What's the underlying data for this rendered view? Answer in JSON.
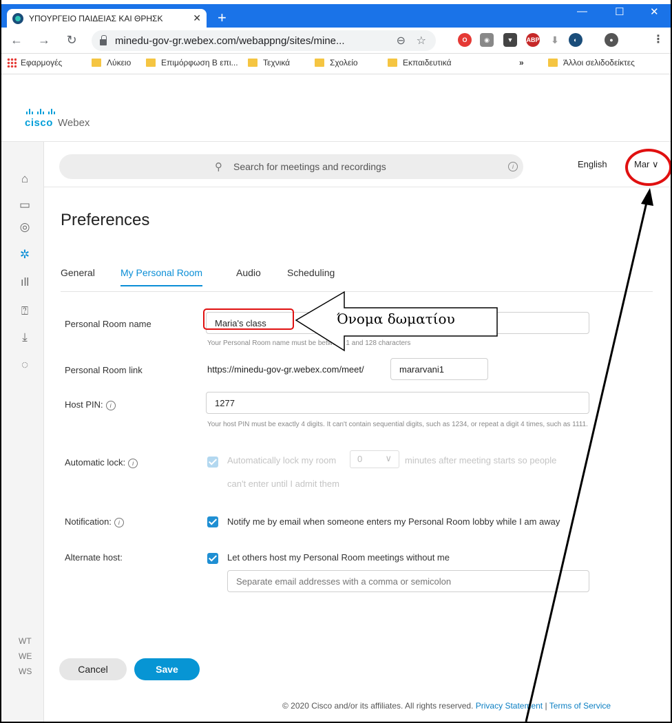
{
  "browser": {
    "tab_title": "ΥΠΟΥΡΓΕΙΟ ΠΑΙΔΕΙΑΣ ΚΑΙ ΘΡΗΣΚ",
    "url": "minedu-gov-gr.webex.com/webappng/sites/mine...",
    "bookmarks": [
      "Εφαρμογές",
      "Λύκειο",
      "Επιμόρφωση Β επι...",
      "Τεχνικά",
      "Σχολείο",
      "Εκπαιδευτικά"
    ],
    "more_bookmarks": "»",
    "other_bookmarks": "Άλλοι σελιδοδείκτες"
  },
  "brand": {
    "cisco": "cisco",
    "webex": "Webex"
  },
  "header": {
    "search_placeholder": "Search for meetings and recordings",
    "language": "English",
    "user": "Mar"
  },
  "rail": {
    "bottom_items": [
      "WT",
      "WE",
      "WS"
    ]
  },
  "page": {
    "title": "Preferences",
    "tabs": [
      "General",
      "My Personal Room",
      "Audio",
      "Scheduling"
    ],
    "active_tab": "My Personal Room"
  },
  "form": {
    "room_name_label": "Personal Room name",
    "room_name_value": "Maria's class",
    "room_name_hint": "Your Personal Room name must be between 1 and 128 characters",
    "room_link_label": "Personal Room link",
    "room_link_prefix": "https://minedu-gov-gr.webex.com/meet/",
    "room_link_value": "mararvani1",
    "host_pin_label": "Host PIN:",
    "host_pin_value": "1277",
    "host_pin_hint": "Your host PIN must be exactly 4 digits. It can't contain sequential digits, such as 1234, or repeat a digit 4 times, such as 1111.",
    "auto_lock_label": "Automatic lock:",
    "auto_lock_text_a": "Automatically lock my room",
    "auto_lock_minutes": "0",
    "auto_lock_text_b": "minutes after meeting starts so people",
    "auto_lock_text_c": "can't enter until I admit them",
    "notification_label": "Notification:",
    "notification_text": "Notify me by email when someone enters my Personal Room lobby while I am away",
    "alt_host_label": "Alternate host:",
    "alt_host_text": "Let others host my Personal Room meetings without me",
    "alt_host_placeholder": "Separate email addresses with a comma or semicolon"
  },
  "buttons": {
    "cancel": "Cancel",
    "save": "Save"
  },
  "footer": {
    "copyright": "© 2020 Cisco and/or its affiliates. All rights reserved.",
    "privacy": "Privacy Statement",
    "separator": "|",
    "terms": "Terms of Service"
  },
  "annotation": {
    "label": "Όνομα δωματίου",
    "color": "#e01010"
  }
}
